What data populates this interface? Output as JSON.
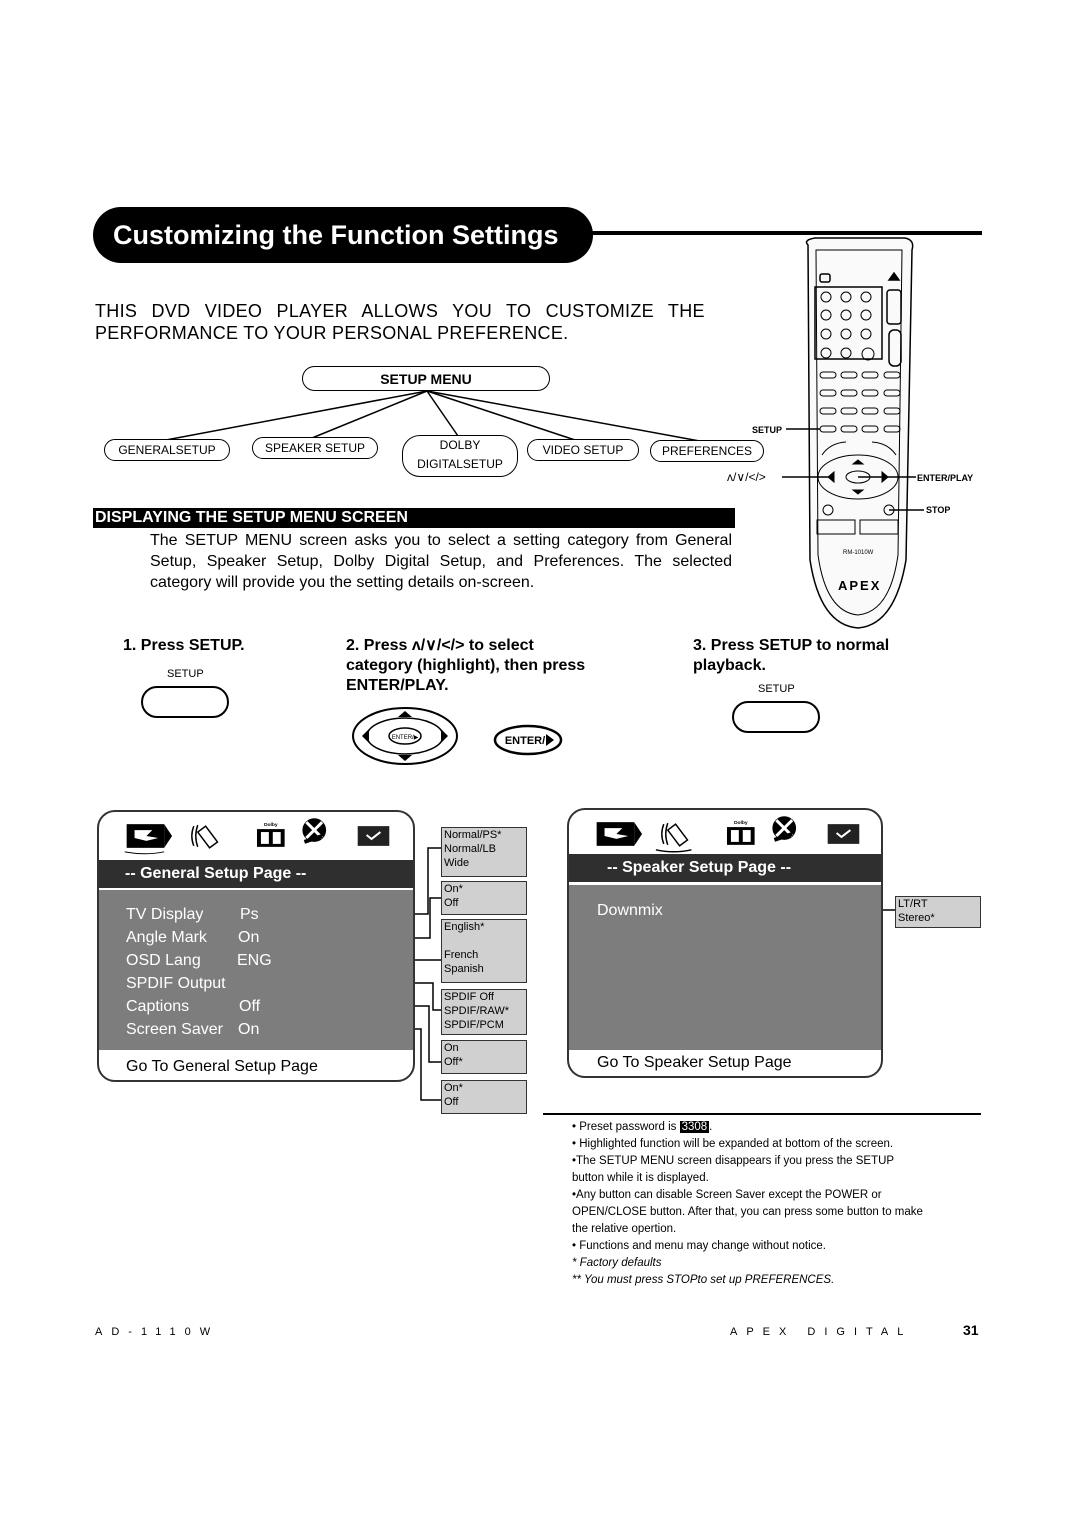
{
  "page": {
    "title": "Customizing the Function Settings",
    "intro_line1": "THIS DVD VIDEO PLAYER ALLOWS YOU TO CUSTOMIZE THE",
    "intro_line2": "PERFORMANCE TO YOUR PERSONAL PREFERENCE."
  },
  "setup_tree": {
    "root": "SETUP MENU",
    "children": [
      {
        "line1": "GENERALSETUP",
        "line2": ""
      },
      {
        "line1": "SPEAKER SETUP",
        "line2": ""
      },
      {
        "line1": "DOLBY",
        "line2": "DIGITALSETUP"
      },
      {
        "line1": "VIDEO SETUP",
        "line2": ""
      },
      {
        "line1": "PREFERENCES",
        "line2": ""
      }
    ]
  },
  "remote": {
    "model": "RM-1010W",
    "brand": "APEX",
    "labels": {
      "setup": "SETUP",
      "arrows": "ʌ/∨/</>",
      "enter_play": "ENTER/PLAY",
      "stop": "STOP"
    }
  },
  "section": {
    "heading": "DISPLAYING THE SETUP MENU SCREEN",
    "body": "The SETUP MENU screen asks you to select a setting category from General Setup, Speaker Setup, Dolby Digital Setup, and Preferences.  The selected category will provide you the setting details on-screen."
  },
  "steps": [
    {
      "title": "1. Press SETUP.",
      "button_label": "SETUP"
    },
    {
      "title_line1": "2. Press ʌ/∨/</>  to select",
      "title_line2": "category (highlight), then press",
      "title_line3": "ENTER/PLAY.",
      "dpad_center": "ENTER/▶",
      "enter_button": "ENTER/▶"
    },
    {
      "title_line1": "3. Press SETUP to normal",
      "title_line2": "playback.",
      "button_label": "SETUP"
    }
  ],
  "osd_icons": {
    "dolby_label": "Dolby"
  },
  "general_osd": {
    "header": "-- General Setup Page --",
    "items": [
      {
        "label": "TV Display",
        "value": "Ps"
      },
      {
        "label": "Angle Mark",
        "value": "On"
      },
      {
        "label": "OSD Lang",
        "value": "ENG"
      },
      {
        "label": "SPDIF Output",
        "value": ""
      },
      {
        "label": "Captions",
        "value": "Off"
      },
      {
        "label": "Screen Saver",
        "value": "On"
      }
    ],
    "footer": "Go To General Setup Page",
    "options": [
      [
        "Normal/PS*",
        "Normal/LB",
        "Wide"
      ],
      [
        "On*",
        "Off"
      ],
      [
        "English*",
        "",
        "French",
        "Spanish"
      ],
      [
        "SPDIF Off",
        "SPDIF/RAW*",
        "SPDIF/PCM"
      ],
      [
        "On",
        "Off*"
      ],
      [
        "On*",
        "Off"
      ]
    ]
  },
  "speaker_osd": {
    "header": "-- Speaker Setup Page --",
    "items": [
      {
        "label": "Downmix",
        "value": ""
      }
    ],
    "footer": "Go To Speaker Setup Page",
    "options": [
      [
        "LT/RT",
        "Stereo*"
      ]
    ]
  },
  "notes": {
    "n1_pre": "• Preset password is ",
    "password": "3308",
    "n1_post": ".",
    "n2": "• Highlighted function will be expanded at bottom of the screen.",
    "n3a": "•The SETUP MENU screen disappears if you press the SETUP",
    "n3b": "  button while it is displayed.",
    "n4a": "•Any button can disable Screen Saver except the POWER or",
    "n4b": " OPEN/CLOSE button. After that, you can press some button to make",
    "n4c": " the relative opertion.",
    "n5": "• Functions and menu may change without notice.",
    "n6": "* Factory defaults",
    "n7": "** You must press STOPto set up PREFERENCES."
  },
  "footer": {
    "model": "AD-1110W",
    "brand": "APEX DIGITAL",
    "page_number": "31"
  }
}
